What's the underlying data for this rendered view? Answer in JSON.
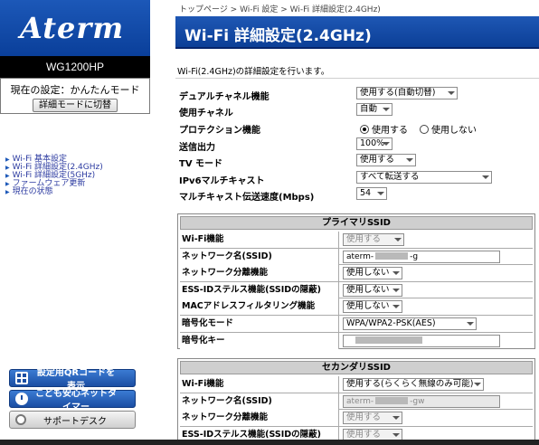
{
  "sidebar": {
    "logo": "Aterm",
    "model": "WG1200HP",
    "current_mode": "現在の設定：かんたんモード",
    "switch_button": "詳細モードに切替",
    "nav": [
      {
        "label": "Wi-Fi 基本設定"
      },
      {
        "label": "Wi-Fi 詳細設定(2.4GHz)"
      },
      {
        "label": "Wi-Fi 詳細設定(5GHz)"
      },
      {
        "label": "ファームウェア更新"
      },
      {
        "label": "現在の状態"
      }
    ],
    "qr_button": "設定用QRコードを表示",
    "timer_button": "こども安心ネットタイマー",
    "support_button": "サポートデスク"
  },
  "breadcrumb": "トップページ > Wi-Fi 設定 > Wi-Fi 詳細設定(2.4GHz)",
  "page_title": "Wi-Fi 詳細設定(2.4GHz)",
  "description": "Wi-Fi(2.4GHz)の詳細設定を行います。",
  "settings": {
    "dual_channel": {
      "label": "デュアルチャネル機能",
      "value": "使用する(自動切替)"
    },
    "channel": {
      "label": "使用チャネル",
      "value": "自動"
    },
    "protection": {
      "label": "プロテクション機能",
      "option_on": "使用する",
      "option_off": "使用しない",
      "selected": "on"
    },
    "tx_power": {
      "label": "送信出力",
      "value": "100%"
    },
    "tv_mode": {
      "label": "TV モード",
      "value": "使用する"
    },
    "ipv6_multicast": {
      "label": "IPv6マルチキャスト",
      "value": "すべて転送する"
    },
    "multicast_rate": {
      "label": "マルチキャスト伝送速度(Mbps)",
      "value": "54"
    }
  },
  "primary_ssid": {
    "title": "プライマリSSID",
    "rows": [
      {
        "label": "Wi-Fi機能",
        "value": "使用する",
        "disabled": true
      },
      {
        "label": "ネットワーク名(SSID)",
        "value_prefix": "aterm-",
        "value_suffix": "-g"
      },
      {
        "label": "ネットワーク分離機能",
        "value": "使用しない"
      },
      {
        "label": "ESS-IDステルス機能(SSIDの隠蔽)",
        "value": "使用しない"
      },
      {
        "label": "MACアドレスフィルタリング機能",
        "value": "使用しない"
      },
      {
        "label": "暗号化モード",
        "value": "WPA/WPA2-PSK(AES)"
      },
      {
        "label": "暗号化キー",
        "value": ""
      }
    ]
  },
  "secondary_ssid": {
    "title": "セカンダリSSID",
    "rows": [
      {
        "label": "Wi-Fi機能",
        "value": "使用する(らくらく無線のみ可能)"
      },
      {
        "label": "ネットワーク名(SSID)",
        "value_prefix": "aterm-",
        "value_suffix": "-gw"
      },
      {
        "label": "ネットワーク分離機能",
        "value": "使用する"
      },
      {
        "label": "ESS-IDステルス機能(SSIDの隠蔽)",
        "value": "使用する"
      }
    ]
  },
  "colors": {
    "header_blue": "#1e57b4",
    "nav_link": "#2b3aa0"
  }
}
